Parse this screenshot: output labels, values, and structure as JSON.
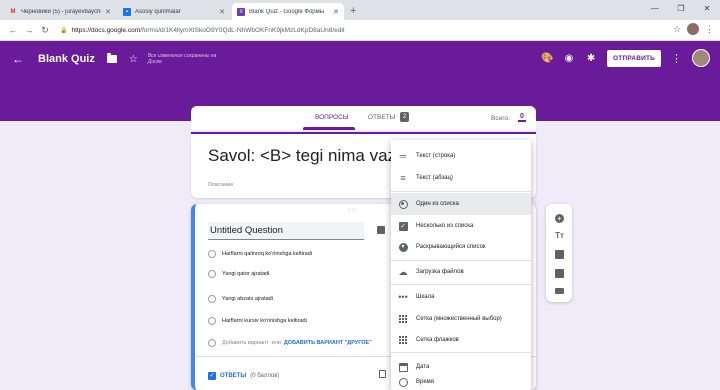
{
  "browser": {
    "tabs": [
      {
        "title": "Черновики (5) - jurayevbaychi0",
        "favicon": "gmail-icon",
        "active": false
      },
      {
        "title": "Asosiy qurilmalar",
        "favicon": "site-icon",
        "active": false
      },
      {
        "title": "Blank Quiz - Google Формы",
        "favicon": "forms-icon",
        "active": true
      }
    ],
    "url_host": "https://docs.google.com",
    "url_path": "/forms/d/1K4llymXtSkoO9Y0QdL-NhWbOKFnK9jkMzLdKpD8aUn8/edit"
  },
  "header": {
    "title": "Blank Quiz",
    "saved_text": "Все изменения сохранены на Диске",
    "send_label": "ОТПРАВИТЬ"
  },
  "tabs": {
    "questions": "ВОПРОСЫ",
    "answers": "ОТВЕТЫ",
    "answers_count": "2",
    "total_label": "Всего:",
    "total_value": "0"
  },
  "form": {
    "title": "Savol: <B> tegi nima vazifa",
    "description": "Описание"
  },
  "question": {
    "title": "Untitled Question",
    "options": [
      "Harflarni qalinroq ko'rinishga keltiradi",
      "Yangi qator ajratadi",
      "Yangi abzats ajratadi",
      "Harflarni kursiv ko'rinishga keltiradi"
    ],
    "add_option": "Добавить вариант",
    "or": "или",
    "add_other": "ДОБАВИТЬ ВАРИАНТ \"ДРУГОЕ\"",
    "answers_label": "ОТВЕТЫ",
    "points": "(0 баллов)"
  },
  "menu": {
    "items": [
      {
        "label": "Текст (строка)",
        "icon": "short-text-icon"
      },
      {
        "label": "Текст (абзац)",
        "icon": "paragraph-icon"
      },
      {
        "label": "Один из списка",
        "icon": "radio-icon"
      },
      {
        "label": "Несколько из списка",
        "icon": "checkbox-icon"
      },
      {
        "label": "Раскрывающийся список",
        "icon": "dropdown-icon"
      },
      {
        "label": "Загрузка файлов",
        "icon": "cloud-upload-icon"
      },
      {
        "label": "Шкала",
        "icon": "linear-scale-icon"
      },
      {
        "label": "Сетка (множественный выбор)",
        "icon": "grid-icon"
      },
      {
        "label": "Сетка флажков",
        "icon": "checkbox-grid-icon"
      },
      {
        "label": "Дата",
        "icon": "calendar-icon"
      },
      {
        "label": "Время",
        "icon": "clock-icon"
      }
    ],
    "selected_index": 2
  },
  "colors": {
    "primary": "#6a1b9a",
    "background": "#f0ebf8",
    "accent_blue": "#4285f4"
  }
}
